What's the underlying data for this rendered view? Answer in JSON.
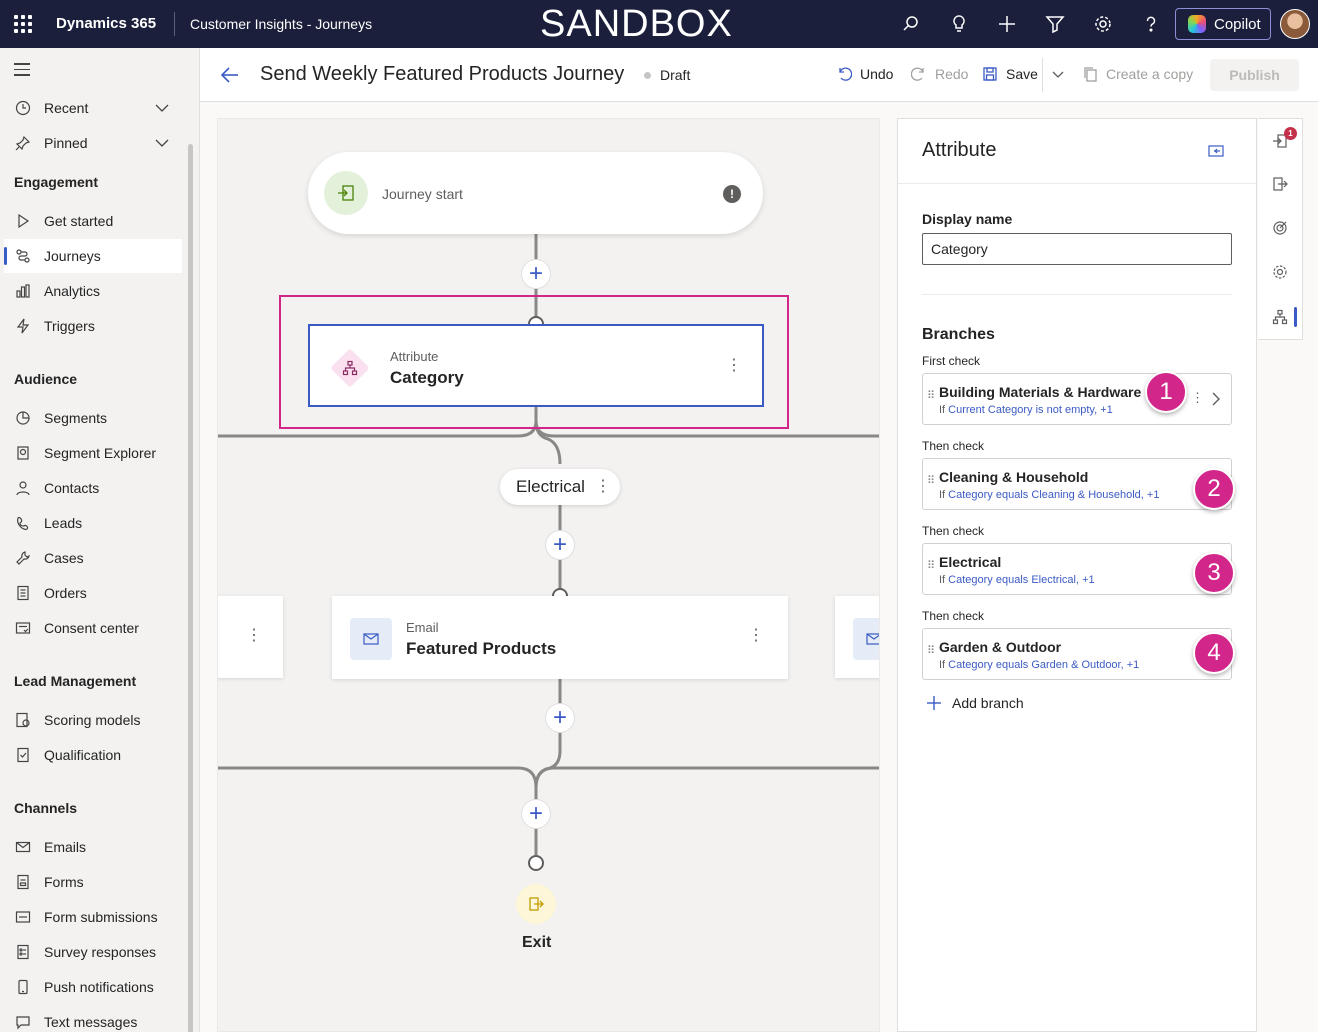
{
  "topbar": {
    "app_name": "Dynamics 365",
    "area_name": "Customer Insights - Journeys",
    "environment_banner": "SANDBOX",
    "copilot_label": "Copilot",
    "icons": [
      "search-icon",
      "lightbulb-icon",
      "plus-icon",
      "filter-icon",
      "gear-icon",
      "help-icon"
    ]
  },
  "sidebar": {
    "top_items": [
      {
        "label": "Recent",
        "icon": "clock-icon"
      },
      {
        "label": "Pinned",
        "icon": "pin-icon"
      }
    ],
    "sections": [
      {
        "title": "Engagement",
        "items": [
          {
            "label": "Get started",
            "icon": "play-icon"
          },
          {
            "label": "Journeys",
            "icon": "journey-icon",
            "active": true
          },
          {
            "label": "Analytics",
            "icon": "analytics-icon"
          },
          {
            "label": "Triggers",
            "icon": "trigger-icon"
          }
        ]
      },
      {
        "title": "Audience",
        "items": [
          {
            "label": "Segments",
            "icon": "segments-icon"
          },
          {
            "label": "Segment Explorer",
            "icon": "segment-explorer-icon"
          },
          {
            "label": "Contacts",
            "icon": "contact-icon"
          },
          {
            "label": "Leads",
            "icon": "leads-icon"
          },
          {
            "label": "Cases",
            "icon": "wrench-icon"
          },
          {
            "label": "Orders",
            "icon": "document-icon"
          },
          {
            "label": "Consent center",
            "icon": "consent-icon"
          }
        ]
      },
      {
        "title": "Lead Management",
        "items": [
          {
            "label": "Scoring models",
            "icon": "scoring-icon"
          },
          {
            "label": "Qualification",
            "icon": "qualification-icon"
          }
        ]
      },
      {
        "title": "Channels",
        "items": [
          {
            "label": "Emails",
            "icon": "mail-icon"
          },
          {
            "label": "Forms",
            "icon": "form-icon"
          },
          {
            "label": "Form submissions",
            "icon": "form-submissions-icon"
          },
          {
            "label": "Survey responses",
            "icon": "survey-icon"
          },
          {
            "label": "Push notifications",
            "icon": "push-icon"
          },
          {
            "label": "Text messages",
            "icon": "sms-icon"
          }
        ]
      }
    ]
  },
  "command_bar": {
    "title": "Send Weekly Featured Products Journey",
    "status": "Draft",
    "undo": "Undo",
    "redo": "Redo",
    "save": "Save",
    "create_copy": "Create a copy",
    "publish": "Publish"
  },
  "canvas": {
    "start_label": "Journey start",
    "start_warning": "!",
    "attribute_node": {
      "type_label": "Attribute",
      "name": "Category"
    },
    "branch_pill": "Electrical",
    "email_node": {
      "type_label": "Email",
      "name": "Featured Products"
    },
    "exit_label": "Exit"
  },
  "panel": {
    "title": "Attribute",
    "display_name_label": "Display name",
    "display_name_value": "Category",
    "branches_heading": "Branches",
    "branches": [
      {
        "check_label": "First check",
        "name": "Building Materials & Hardware",
        "cond_prefix": "If ",
        "cond_link": "Current Category is not empty,",
        "cond_suffix": " +1",
        "marker": "1"
      },
      {
        "check_label": "Then check",
        "name": "Cleaning & Household",
        "cond_prefix": "If ",
        "cond_link": "Category equals Cleaning & Household,",
        "cond_suffix": " +1",
        "marker": "2"
      },
      {
        "check_label": "Then check",
        "name": "Electrical",
        "cond_prefix": "If ",
        "cond_link": "Category equals Electrical,",
        "cond_suffix": " +1",
        "marker": "3"
      },
      {
        "check_label": "Then check",
        "name": "Garden & Outdoor",
        "cond_prefix": "If ",
        "cond_link": "Category equals Garden & Outdoor,",
        "cond_suffix": " +1",
        "marker": "4"
      }
    ],
    "add_branch": "Add branch"
  },
  "rail": {
    "notification_count": "1"
  },
  "colors": {
    "topbar": "#1b1f3b",
    "accent": "#3b5bc4",
    "highlight": "#d3268b"
  }
}
